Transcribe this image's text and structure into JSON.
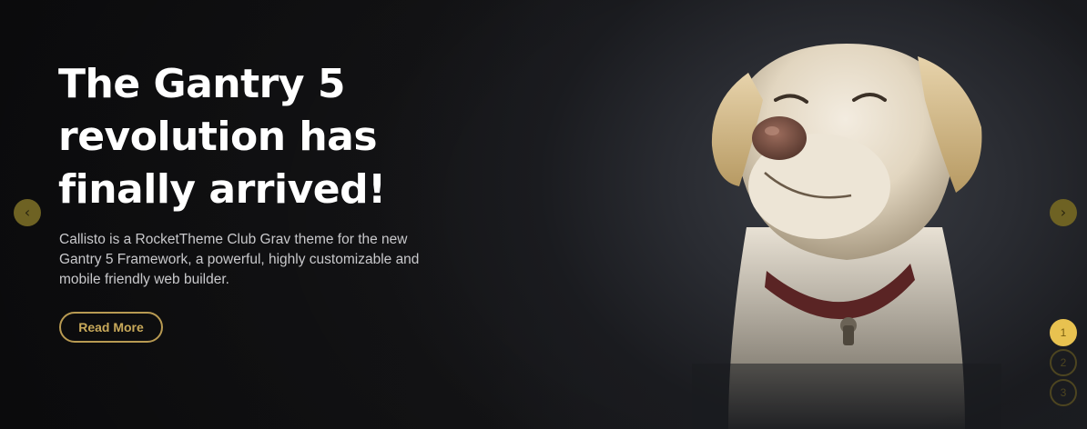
{
  "slide": {
    "headline": "The Gantry 5 revolution has finally arrived!",
    "description": "Callisto is a RocketTheme Club Grav theme for the new Gantry 5 Framework, a powerful, highly customizable and mobile friendly web builder.",
    "button_label": "Read More"
  },
  "navigation": {
    "prev_icon": "‹",
    "next_icon": "›",
    "pages": [
      "1",
      "2",
      "3"
    ],
    "active_page": "1"
  },
  "colors": {
    "accent": "#e8c250",
    "button_border": "#b89a52",
    "arrow_bg": "#6e6223",
    "background": "#101012"
  },
  "image": {
    "subject": "dog-photo"
  }
}
